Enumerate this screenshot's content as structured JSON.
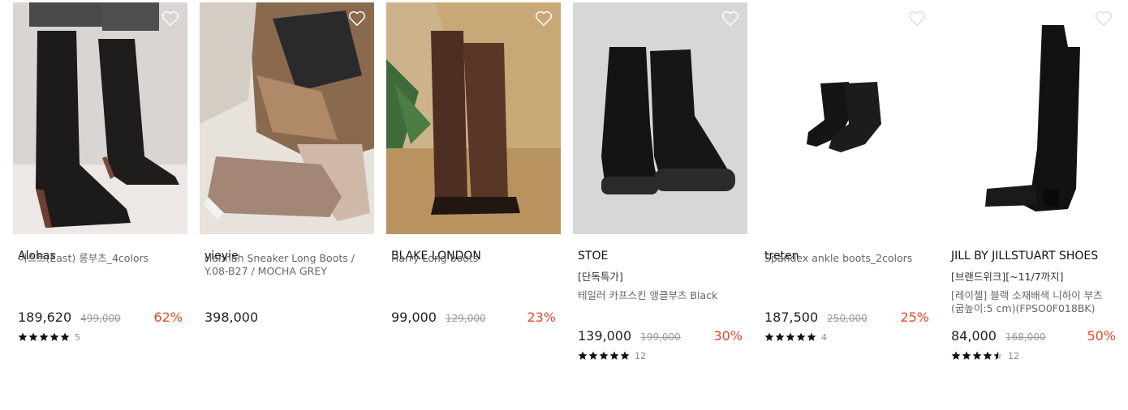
{
  "products": [
    {
      "brand": "Alohas",
      "tag": "",
      "name": "이스트(East) 롱부츠_4colors",
      "price": "189,620",
      "original_price": "499,000",
      "discount": "62%",
      "rating_stars": 5,
      "review_count": "5",
      "image": "knee-high-black-boots-on-model"
    },
    {
      "brand": "yieyie",
      "tag": "",
      "name": "Hannah Sneaker Long Boots / Y.08-B27 / MOCHA GREY",
      "price": "398,000",
      "original_price": "",
      "discount": "",
      "rating_stars": 0,
      "review_count": "",
      "image": "mocha-grey-sneaker-boots-on-model"
    },
    {
      "brand": "BLAKE LONDON",
      "tag": "",
      "name": "Harry Long boots",
      "price": "99,000",
      "original_price": "129,000",
      "discount": "23%",
      "rating_stars": 0,
      "review_count": "",
      "image": "brown-long-boots-on-rattan-chair"
    },
    {
      "brand": "STOE",
      "tag": "[단독특가]",
      "name": "테일러 카프스킨 앵클부츠 Black",
      "price": "139,000",
      "original_price": "199,000",
      "discount": "30%",
      "rating_stars": 5,
      "review_count": "12",
      "image": "black-chunky-ankle-boots"
    },
    {
      "brand": "treten",
      "tag": "",
      "name": "Spandex ankle boots_2colors",
      "price": "187,500",
      "original_price": "250,000",
      "discount": "25%",
      "rating_stars": 5,
      "review_count": "4",
      "image": "black-spandex-ankle-boots"
    },
    {
      "brand": "JILL BY JILLSTUART SHOES",
      "tag": "[브랜드위크][~11/7까지]",
      "name": "[레이첼] 블랙 소재배색 니하이 부츠(굽높이:5 cm)(FPSO0F018BK)",
      "price": "84,000",
      "original_price": "168,000",
      "discount": "50%",
      "rating_stars": 4.5,
      "review_count": "12",
      "image": "black-over-knee-boot"
    }
  ],
  "colors": {
    "discount": "#e8472a",
    "star": "#111111",
    "wish_icon": "#ffffff"
  }
}
